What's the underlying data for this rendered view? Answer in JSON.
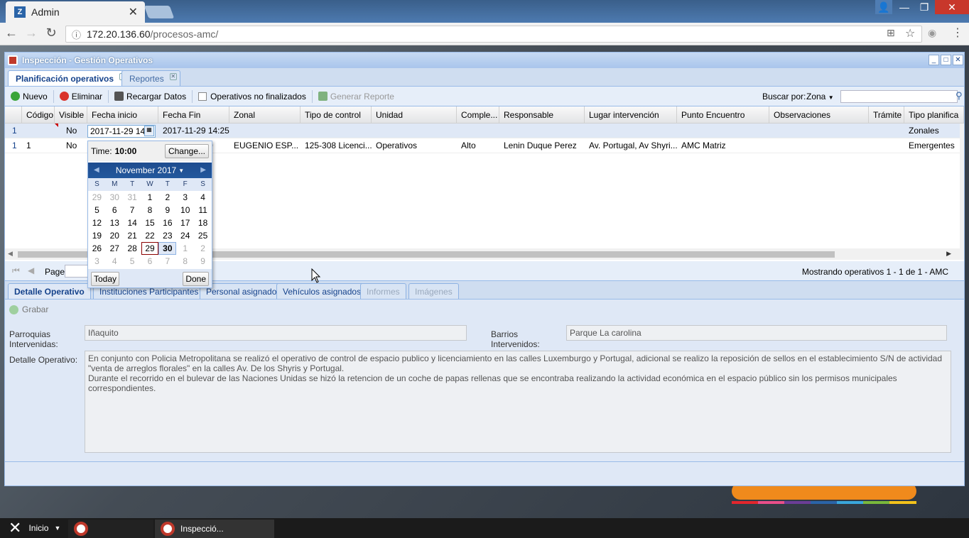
{
  "browser": {
    "tab_title": "Admin",
    "tab_icon": "app-favicon",
    "url_host": "172.20.136.60",
    "url_path": "/procesos-amc/"
  },
  "window": {
    "title": "Inspección - Gestión Operativos"
  },
  "page_tabs": [
    {
      "label": "Planificación operativos"
    },
    {
      "label": "Reportes"
    }
  ],
  "toolbar": {
    "nuevo": "Nuevo",
    "eliminar": "Eliminar",
    "recargar": "Recargar Datos",
    "no_finalizados": "Operativos no finalizados",
    "generar": "Generar Reporte",
    "buscar_label": "Buscar por:",
    "buscar_field": "Zona"
  },
  "grid": {
    "columns": [
      "Código",
      "Visible",
      "Fecha inicio",
      "Fecha Fin",
      "Zonal",
      "Tipo de control",
      "Unidad",
      "Comple...",
      "Responsable",
      "Lugar intervención",
      "Punto Encuentro",
      "Observaciones",
      "Trámite",
      "Tipo planifica"
    ],
    "rows": [
      {
        "num": "1",
        "codigo": "",
        "visible": "No",
        "fecha_inicio": "2017-11-29 14:",
        "fecha_fin": "2017-11-29 14:25",
        "zonal": "",
        "tipo": "",
        "unidad": "",
        "comple": "",
        "responsable": "",
        "lugar": "",
        "punto": "",
        "obs": "",
        "tramite": "",
        "tipo_plan": "Zonales"
      },
      {
        "num": "1",
        "codigo": "1",
        "visible": "No",
        "fecha_inicio": "",
        "fecha_fin": ":30",
        "zonal": "EUGENIO ESP...",
        "tipo": "125-308 Licenci...",
        "unidad": "Operativos",
        "comple": "Alto",
        "responsable": "Lenin Duque Perez",
        "lugar": "Av. Portugal, Av Shyri...",
        "punto": "AMC Matriz",
        "obs": "",
        "tramite": "",
        "tipo_plan": "Emergentes"
      }
    ]
  },
  "paging": {
    "page_label": "Page",
    "summary": "Mostrando operativos 1 - 1 de 1 - AMC"
  },
  "datepicker": {
    "time_label": "Time:",
    "time_value": "10:00",
    "change": "Change...",
    "month": "November 2017",
    "day_names": [
      "S",
      "M",
      "T",
      "W",
      "T",
      "F",
      "S"
    ],
    "days": [
      [
        "29",
        "30",
        "31",
        "1",
        "2",
        "3",
        "4"
      ],
      [
        "5",
        "6",
        "7",
        "8",
        "9",
        "10",
        "11"
      ],
      [
        "12",
        "13",
        "14",
        "15",
        "16",
        "17",
        "18"
      ],
      [
        "19",
        "20",
        "21",
        "22",
        "23",
        "24",
        "25"
      ],
      [
        "26",
        "27",
        "28",
        "29",
        "30",
        "1",
        "2"
      ],
      [
        "3",
        "4",
        "5",
        "6",
        "7",
        "8",
        "9"
      ]
    ],
    "today_btn": "Today",
    "done_btn": "Done"
  },
  "detail_tabs": [
    {
      "label": "Detalle Operativo"
    },
    {
      "label": "Instituciones Participantes"
    },
    {
      "label": "Personal asignado"
    },
    {
      "label": "Vehículos asignados"
    },
    {
      "label": "Informes"
    },
    {
      "label": "Imágenes"
    }
  ],
  "detail": {
    "grabar": "Grabar",
    "parroquias_label": "Parroquias Intervenidas:",
    "parroquias_value": "Iñaquito",
    "barrios_label": "Barrios Intervenidos:",
    "barrios_value": "Parque La carolina",
    "detalle_label": "Detalle Operativo:",
    "detalle_p1": "En conjunto con Policia Metropolitana se realizó el operativo de control de espacio publico y licenciamiento en las calles Luxemburgo y Portugal, adicional se realizo la reposición de sellos en el establecimiento S/N de actividad \"venta de arreglos florales\" en la calles Av. De los Shyris y Portugal.",
    "detalle_p2": "Durante el recorrido en el bulevar de las Naciones Unidas se hizó la retencion de un coche de papas rellenas que se encontraba realizando la actividad económica en el espacio público sin los permisos municipales correspondientes."
  },
  "taskbar": {
    "start": "Inicio",
    "app_label": "Inspecció..."
  },
  "colors": {
    "accent": "#15428b",
    "window_bg": "#dfe8f6",
    "border": "#99bbe8"
  }
}
